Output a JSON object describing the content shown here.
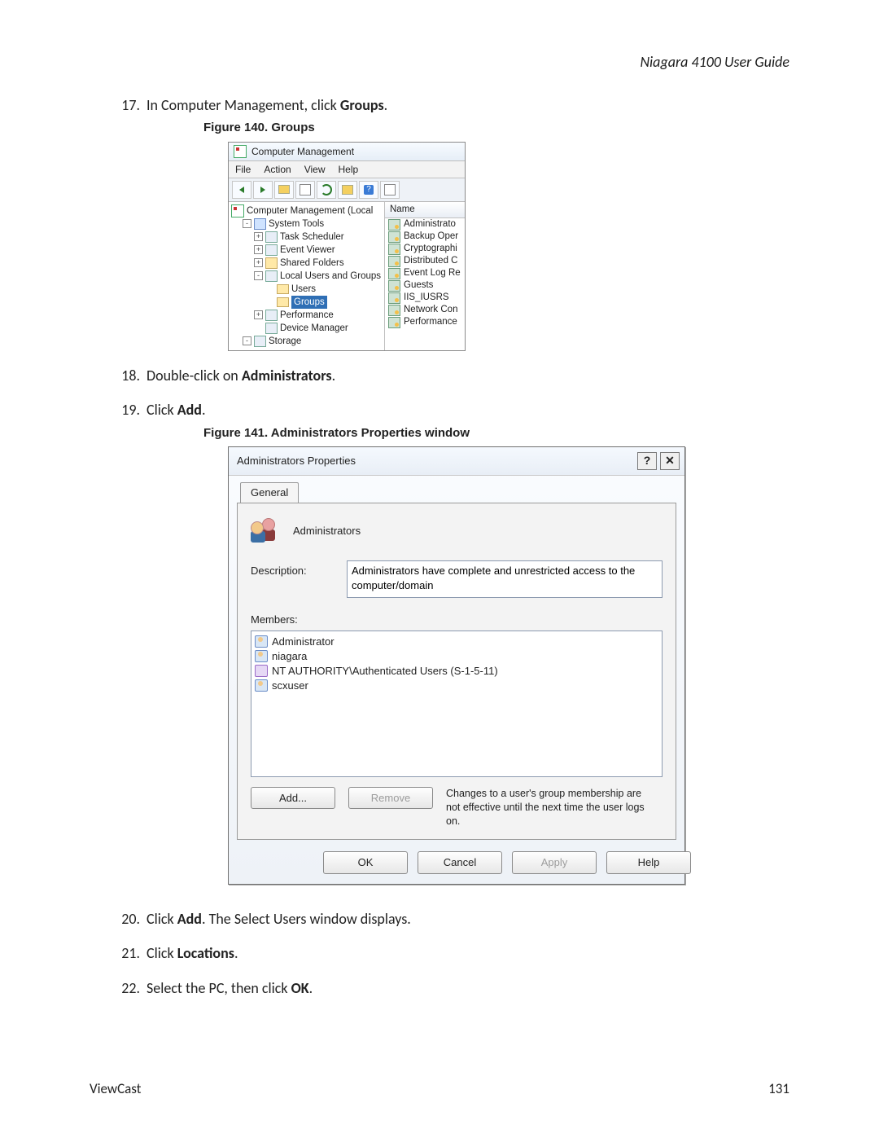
{
  "header": {
    "title": "Niagara 4100 User Guide"
  },
  "steps": {
    "s17": {
      "num": "17.",
      "pre": "In Computer Management, click ",
      "bold": "Groups",
      "post": "."
    },
    "s18": {
      "num": "18.",
      "pre": "Double-click on ",
      "bold": "Administrators",
      "post": "."
    },
    "s19": {
      "num": "19.",
      "pre": "Click ",
      "bold": "Add",
      "post": "."
    },
    "s20": {
      "num": "20.",
      "pre": "Click ",
      "bold": "Add",
      "post": ". The Select Users window displays."
    },
    "s21": {
      "num": "21.",
      "pre": "Click ",
      "bold": "Locations",
      "post": "."
    },
    "s22": {
      "num": "22.",
      "pre": "Select the PC, then click ",
      "bold": "OK",
      "post": "."
    }
  },
  "fig140": {
    "caption": "Figure 140. Groups",
    "title": "Computer Management",
    "menu": {
      "file": "File",
      "action": "Action",
      "view": "View",
      "help": "Help"
    },
    "tree": {
      "root": "Computer Management (Local",
      "systools": "System Tools",
      "tasksched": "Task Scheduler",
      "eventviewer": "Event Viewer",
      "sharedfolders": "Shared Folders",
      "lug": "Local Users and Groups",
      "users": "Users",
      "groups": "Groups",
      "performance": "Performance",
      "devmgr": "Device Manager",
      "storage": "Storage"
    },
    "list": {
      "header": "Name",
      "items": [
        "Administrato",
        "Backup Oper",
        "Cryptographi",
        "Distributed C",
        "Event Log Re",
        "Guests",
        "IIS_IUSRS",
        "Network Con",
        "Performance"
      ]
    }
  },
  "fig141": {
    "caption": "Figure 141. Administrators Properties window",
    "title": "Administrators Properties",
    "tab_general": "General",
    "group_name": "Administrators",
    "desc_label": "Description:",
    "desc_value": "Administrators have complete and unrestricted access to the computer/domain",
    "members_label": "Members:",
    "members": [
      "Administrator",
      "niagara",
      "NT AUTHORITY\\Authenticated Users (S-1-5-11)",
      "scxuser"
    ],
    "btn_add": "Add...",
    "btn_remove": "Remove",
    "note": "Changes to a user's group membership are not effective until the next time the user logs on.",
    "btn_ok": "OK",
    "btn_cancel": "Cancel",
    "btn_apply": "Apply",
    "btn_help": "Help"
  },
  "footer": {
    "left": "ViewCast",
    "right": "131"
  }
}
